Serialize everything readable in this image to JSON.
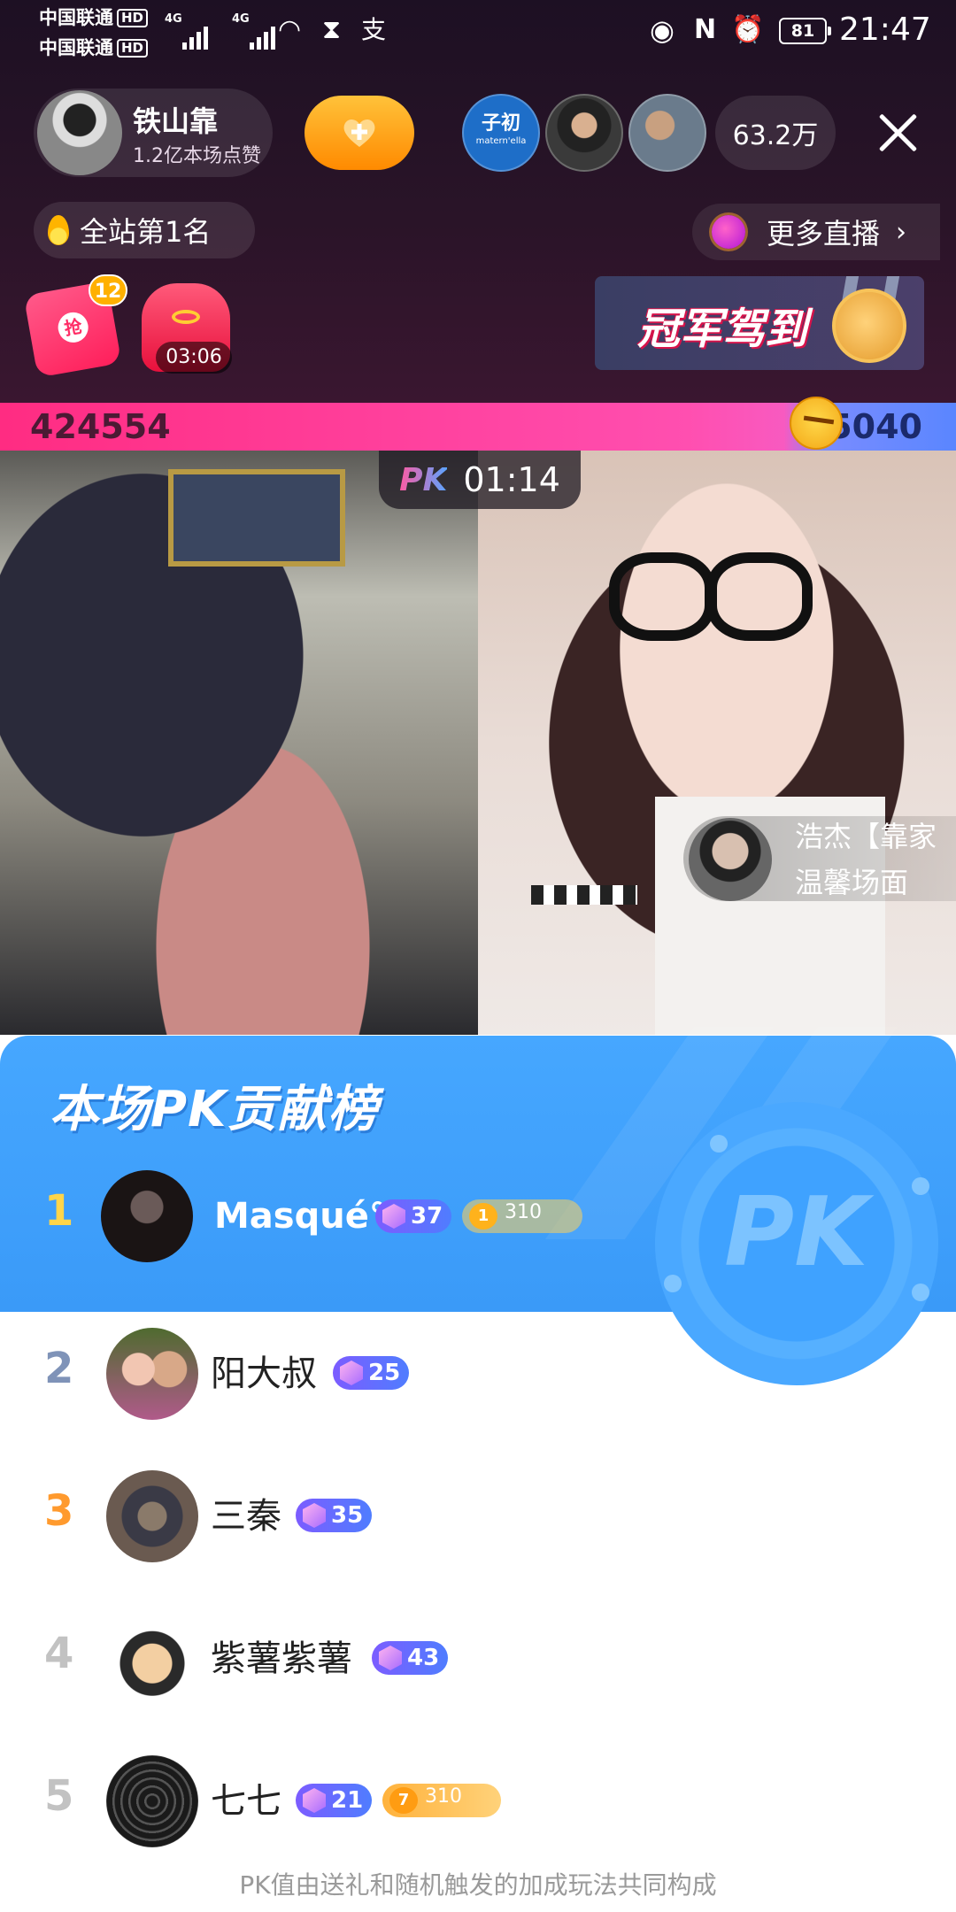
{
  "status_bar": {
    "carrier1": "中国联通",
    "carrier2": "中国联通",
    "hd": "HD",
    "net1": "4G",
    "net2": "4G",
    "battery": "81",
    "time": "21:47"
  },
  "host": {
    "name": "铁山靠",
    "likes": "1.2亿本场点赞",
    "follow_icon": "heart-plus-icon"
  },
  "viewers": {
    "brand1": "子初",
    "brand1_sub": "matern'ella",
    "count": "63.2万"
  },
  "rank": {
    "label": "全站第1名"
  },
  "more_live": {
    "label": "更多直播"
  },
  "red_packet": {
    "badge": "12",
    "char": "抢"
  },
  "gift_bag": {
    "timer": "03:06"
  },
  "banner": {
    "text": "冠军驾到"
  },
  "pk": {
    "left_score": "424554",
    "right_score": "35040",
    "logo": "PK",
    "timer": "01:14"
  },
  "joiner": {
    "name": "浩杰【靠家",
    "text": "温馨场面"
  },
  "board": {
    "title": "本场PK贡献榜",
    "entries": [
      {
        "rank": "1",
        "name": "Masqué°",
        "level": "37",
        "fan_level": "1",
        "fan_value": "310",
        "rank_color": "#ffd54a"
      },
      {
        "rank": "2",
        "name": "阳大叔",
        "level": "25",
        "rank_color": "#7f93b8"
      },
      {
        "rank": "3",
        "name": "三秦",
        "level": "35",
        "rank_color": "#ff9a2e"
      },
      {
        "rank": "4",
        "name": "紫薯紫薯",
        "level": "43",
        "rank_color": "#c2c2c2"
      },
      {
        "rank": "5",
        "name": "七七",
        "level": "21",
        "fan_level": "7",
        "fan_value": "310",
        "rank_color": "#c2c2c2"
      }
    ],
    "footer": "PK值由送礼和随机触发的加成玩法共同构成"
  }
}
